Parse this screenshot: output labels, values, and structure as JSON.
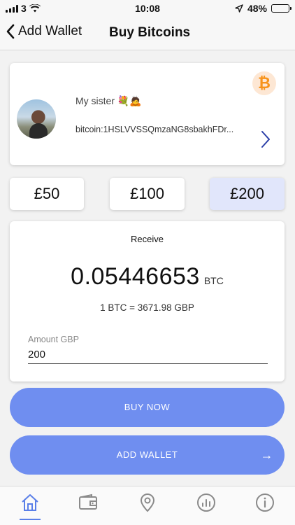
{
  "status_bar": {
    "carrier": "3",
    "time": "10:08",
    "battery": "48%",
    "battery_level": 0.48
  },
  "nav": {
    "back_label": "Add Wallet",
    "title": "Buy Bitcoins"
  },
  "recipient": {
    "name": "My sister 💐🙇",
    "address": "bitcoin:1HSLVVSSQmzaNG8sbakhFDr...",
    "currency_icon": "bitcoin-icon",
    "currency_symbol": "₿"
  },
  "amount_options": [
    {
      "label": "£50",
      "selected": false
    },
    {
      "label": "£100",
      "selected": false
    },
    {
      "label": "£200",
      "selected": true
    }
  ],
  "receive": {
    "label": "Receive",
    "btc_amount": "0.05446653",
    "btc_unit": "BTC",
    "rate": "1 BTC = 3671.98 GBP",
    "field_label": "Amount GBP",
    "field_value": "200"
  },
  "actions": {
    "buy_now": "BUY NOW",
    "add_wallet": "ADD WALLET",
    "add_wallet_arrow": "→"
  },
  "tabs": [
    "home-icon",
    "wallet-icon",
    "location-icon",
    "chart-icon",
    "info-icon"
  ],
  "colors": {
    "accent": "#6f8ef0",
    "selected_amount": "#e1e6fb",
    "bitcoin": "#f7931a",
    "active_tab": "#5a7fe8",
    "inactive_tab": "#8a8a8a"
  }
}
